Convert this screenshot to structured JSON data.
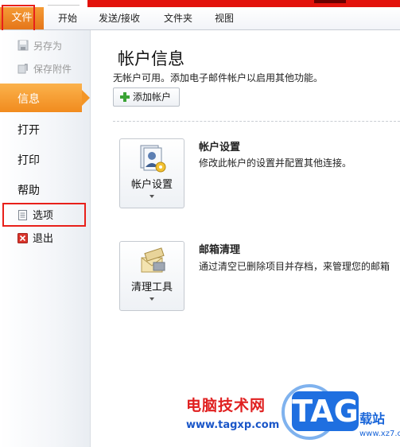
{
  "ribbon": {
    "file_tab": "文件",
    "tabs": [
      "开始",
      "发送/接收",
      "文件夹",
      "视图"
    ]
  },
  "left_panel": {
    "save_as": "另存为",
    "save_attachments": "保存附件",
    "info": "信息",
    "open": "打开",
    "print": "打印",
    "help": "帮助",
    "options": "选项",
    "exit": "退出"
  },
  "main": {
    "title": "帐户信息",
    "subtitle": "无帐户可用。添加电子邮件帐户以启用其他功能。",
    "add_account": "添加帐户",
    "account_settings": {
      "button_label": "帐户设置",
      "title": "帐户设置",
      "description": "修改此帐户的设置并配置其他连接。"
    },
    "mailbox_cleanup": {
      "button_label": "清理工具",
      "title": "邮箱清理",
      "description": "通过清空已删除项目并存档，来管理您的邮箱"
    }
  },
  "watermark": {
    "site_name": "电脑技术网",
    "url": "www.tagxp.com",
    "logo_text": "TAG",
    "side_text": "载站",
    "side_url": "www.xz7.com"
  },
  "colors": {
    "accent_orange": "#f18b1e",
    "highlight_red": "#e8201a",
    "titlebar_red": "#e3120b"
  }
}
